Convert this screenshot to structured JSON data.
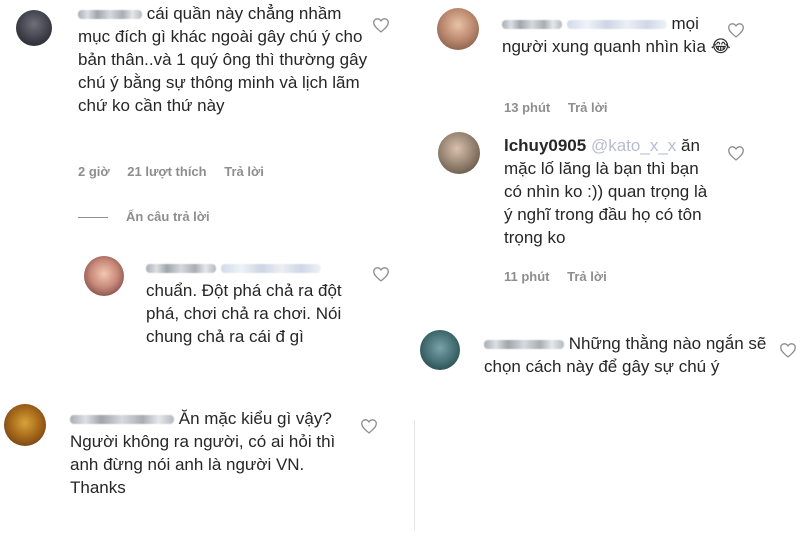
{
  "comments": [
    {
      "id": "c1",
      "text": "cái quần này chẳng nhầm mục đích gì khác ngoài gây chú ý cho bản thân..và 1 quý ông thì thường gây chú ý bằng sự thông minh và lịch lãm chứ ko cần thứ này",
      "time": "2 giờ",
      "likes": "21 lượt thích",
      "reply": "Trả lời",
      "hide_replies": "Ẩn câu trả lời"
    },
    {
      "id": "c2",
      "text": "chuẩn. Đột phá chả ra đột phá, chơi chả ra chơi. Nói chung chả ra cái đ gì"
    },
    {
      "id": "c3",
      "text": "Ăn mặc kiểu gì vậy? Người không ra người, có ai hỏi thì anh đừng nói anh là người VN. Thanks"
    },
    {
      "id": "c4",
      "text": "mọi người xung quanh nhìn kìa 😂",
      "time": "13 phút",
      "reply": "Trả lời"
    },
    {
      "id": "c5",
      "username": "lchuy0905",
      "mention": "@kato_x_x",
      "text": "ăn mặc lố lăng là bạn thì bạn có nhìn ko :)) quan trọng là ý nghĩ trong đầu họ có tôn trọng ko",
      "time": "11 phút",
      "reply": "Trả lời"
    },
    {
      "id": "c6",
      "text": "Những thằng nào ngắn sẽ chọn cách này để gây sự chú ý"
    }
  ],
  "icons": {
    "like": "heart-outline-icon"
  }
}
